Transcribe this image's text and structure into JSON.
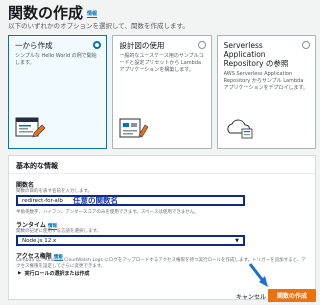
{
  "header": {
    "title": "関数の作成",
    "info": "情報",
    "subtitle": "以下のいずれかのオプションを選択して、関数を作成します。"
  },
  "options": [
    {
      "title": "一から作成",
      "description": "シンプルな Hello World の例で開始します。",
      "selected": true
    },
    {
      "title": "設計図の使用",
      "description": "一般的なユースケース用のサンプルコードと設定プリセットから Lambda アプリケーションを構築します。",
      "selected": false
    },
    {
      "title": "Serverless Application Repository の参照",
      "description": "AWS Serverless Application Repository からサンプル Lambda アプリケーションをデプロイします。",
      "selected": false
    }
  ],
  "basic_info": {
    "header": "基本的な情報",
    "function_name_label": "関数名",
    "function_name_hint": "関数の目的を表す名前を入力します。",
    "function_name_value": "redirect-for-alb",
    "function_name_annotation": "任意の関数名",
    "function_name_rule": "半角英数字、ハイフン、アンダースコアのみを使用できます。スペースは使用できません。",
    "runtime_label": "ランタイム",
    "runtime_info": "情報",
    "runtime_hint": "関数の記述に使用する言語を選択します。",
    "runtime_value": "Node.js 12.x",
    "permission_label": "アクセス権限",
    "permission_info": "情報",
    "permission_desc": "Lambda は、Amazon CloudWatch Logs にログをアップロードするアクセス権限を持つ実行ロールを作成します。トリガーを追加すると、アクセス権限を設定してさらに変更できます。",
    "expander_label": "実行ロールの選択または作成"
  },
  "footer": {
    "cancel_label": "キャンセル",
    "create_label": "関数の作成"
  },
  "colors": {
    "accent": "#0073bb",
    "primary_button": "#ec7211",
    "annotation": "#1f3ba6"
  }
}
